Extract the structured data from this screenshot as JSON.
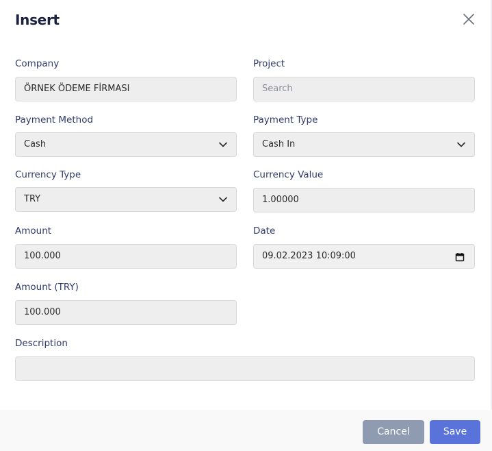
{
  "modal": {
    "title": "Insert"
  },
  "form": {
    "company": {
      "label": "Company",
      "value": "ÖRNEK ÖDEME FİRMASI"
    },
    "project": {
      "label": "Project",
      "placeholder": "Search"
    },
    "payment_method": {
      "label": "Payment Method",
      "value": "Cash"
    },
    "payment_type": {
      "label": "Payment Type",
      "value": "Cash In"
    },
    "currency_type": {
      "label": "Currency Type",
      "value": "TRY"
    },
    "currency_value": {
      "label": "Currency Value",
      "value": "1.00000"
    },
    "amount": {
      "label": "Amount",
      "value": "100.000"
    },
    "date": {
      "label": "Date",
      "value": "09.02.2023 10:09:00"
    },
    "amount_try": {
      "label": "Amount (TRY)",
      "value": "100.000"
    },
    "description": {
      "label": "Description",
      "value": ""
    }
  },
  "footer": {
    "cancel_label": "Cancel",
    "save_label": "Save"
  },
  "icons": {
    "close": "close-icon",
    "dropdown": "chevron-down-icon",
    "calendar": "calendar-icon"
  },
  "colors": {
    "title": "#1b2240",
    "label": "#2e3a69",
    "field_bg": "#eeeeee",
    "cancel": "#8e9bb0",
    "save": "#5a73db"
  }
}
